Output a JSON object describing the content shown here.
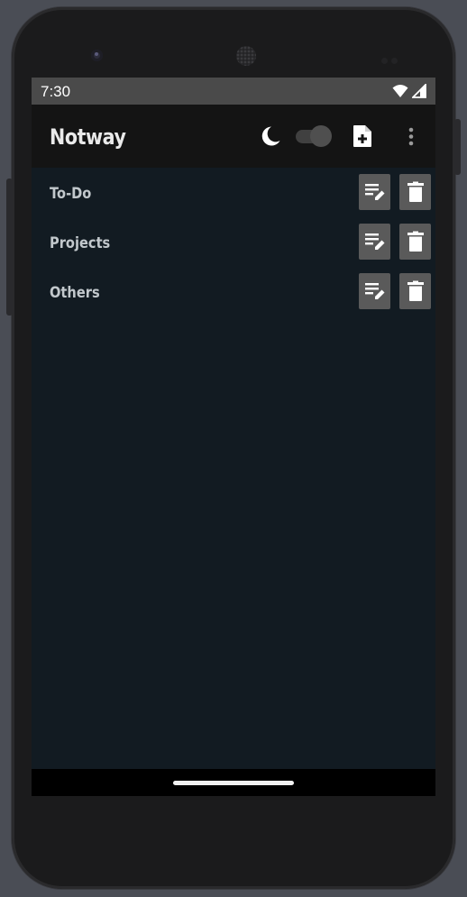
{
  "statusbar": {
    "time": "7:30",
    "icons": [
      "wifi-icon",
      "signal-icon"
    ]
  },
  "appbar": {
    "title": "Notway",
    "icons": [
      "moon-icon",
      "dark-mode-toggle",
      "new-note-icon",
      "more-vert-icon"
    ],
    "dark_mode_on": true
  },
  "categories": [
    {
      "label": "To-Do"
    },
    {
      "label": "Projects"
    },
    {
      "label": "Others"
    }
  ],
  "colors": {
    "background": "#121b22",
    "appbar": "#141414",
    "statusbar": "#4a4a4a",
    "button": "#5a5a5a",
    "label": "#c2c8cc"
  }
}
